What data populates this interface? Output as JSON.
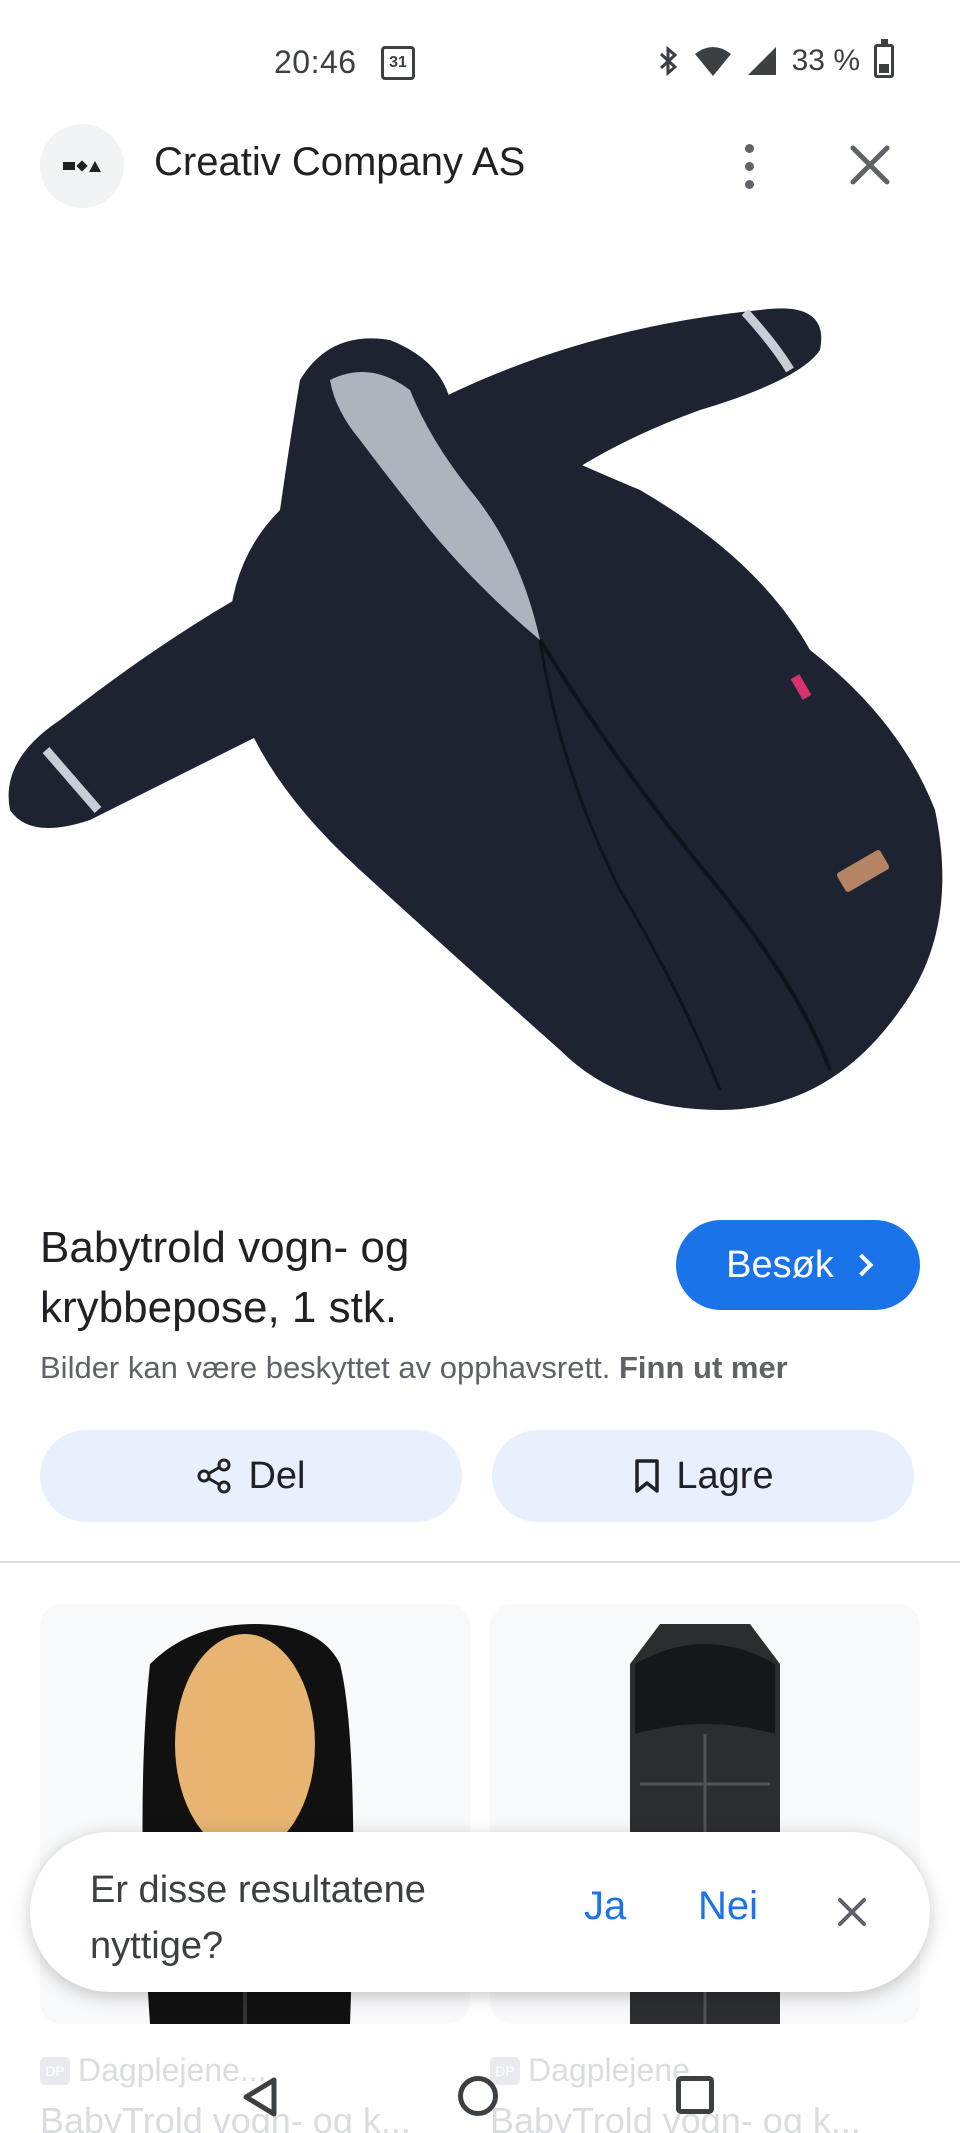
{
  "status_bar": {
    "time": "20:46",
    "calendar_day": "31",
    "battery_percent": "33 %",
    "battery_level": 0.33
  },
  "header": {
    "site_name": "Creativ Company AS"
  },
  "product": {
    "title": "Babytrold vogn- og krybbepose, 1 stk.",
    "visit_label": "Besøk",
    "copyright_text": "Bilder kan være beskyttet av opphavsrett.",
    "learn_more_label": "Finn ut mer"
  },
  "actions": {
    "share_label": "Del",
    "save_label": "Lagre"
  },
  "related": [
    {
      "source": "Dagplejene...",
      "title": "BabyTrold vogn- og k..."
    },
    {
      "source": "Dagplejene...",
      "title": "BabyTrold vogn- og k..."
    }
  ],
  "feedback": {
    "question": "Er disse resultatene nyttige?",
    "yes_label": "Ja",
    "no_label": "Nei"
  },
  "colors": {
    "accent": "#1a73e8",
    "pill_bg": "#e8f0fe",
    "product_fabric": "#1d2331"
  }
}
